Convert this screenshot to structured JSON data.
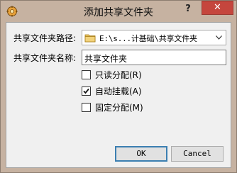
{
  "window": {
    "title": "添加共享文件夹",
    "help_label": "?",
    "close_label": "✕",
    "icon": "virtualbox-gear-icon"
  },
  "form": {
    "path_label": "共享文件夹路径:",
    "path_value": "E:\\s...计基础\\共享文件夹",
    "name_label": "共享文件夹名称:",
    "name_value": "共享文件夹"
  },
  "options": [
    {
      "label": "只读分配(R)",
      "checked": false
    },
    {
      "label": "自动挂载(A)",
      "checked": true
    },
    {
      "label": "固定分配(M)",
      "checked": false
    }
  ],
  "buttons": {
    "ok": "OK",
    "cancel": "Cancel"
  }
}
